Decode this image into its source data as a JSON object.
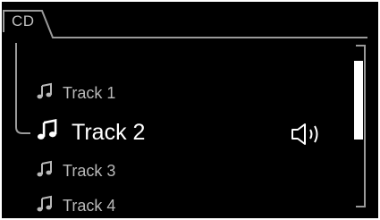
{
  "tab": {
    "label": "CD"
  },
  "tracks": [
    {
      "label": "Track 1"
    },
    {
      "label": "Track 2",
      "selected": true,
      "playing": true
    },
    {
      "label": "Track 3"
    },
    {
      "label": "Track 4"
    }
  ],
  "icons": {
    "track": "music-note-icon",
    "now_playing": "speaker-volume-icon"
  },
  "colors": {
    "background": "#000000",
    "text": "#b8b8b8",
    "selected_text": "#ffffff",
    "frame_lines": "#9a9a9a"
  }
}
